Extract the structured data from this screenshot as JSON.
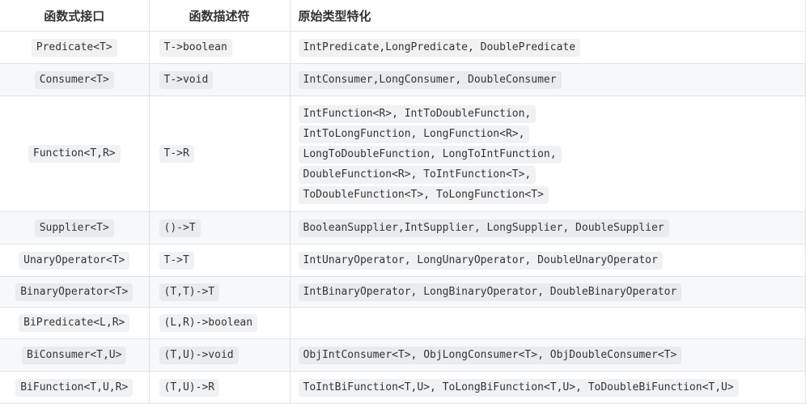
{
  "headers": [
    "函数式接口",
    "函数描述符",
    "原始类型特化"
  ],
  "rows": [
    {
      "iface": "Predicate<T>",
      "desc": "T->boolean",
      "special": [
        "IntPredicate,LongPredicate, DoublePredicate"
      ]
    },
    {
      "iface": "Consumer<T>",
      "desc": "T->void",
      "special": [
        "IntConsumer,LongConsumer, DoubleConsumer"
      ]
    },
    {
      "iface": "Function<T,R>",
      "desc": "T->R",
      "special": [
        "IntFunction<R>, IntToDoubleFunction,",
        "IntToLongFunction, LongFunction<R>,",
        "LongToDoubleFunction, LongToIntFunction,",
        "DoubleFunction<R>, ToIntFunction<T>,",
        "ToDoubleFunction<T>, ToLongFunction<T>"
      ]
    },
    {
      "iface": "Supplier<T>",
      "desc": "()->T",
      "special": [
        "BooleanSupplier,IntSupplier, LongSupplier, DoubleSupplier"
      ]
    },
    {
      "iface": "UnaryOperator<T>",
      "desc": "T->T",
      "special": [
        "IntUnaryOperator, LongUnaryOperator, DoubleUnaryOperator"
      ]
    },
    {
      "iface": "BinaryOperator<T>",
      "desc": "(T,T)->T",
      "special": [
        "IntBinaryOperator, LongBinaryOperator, DoubleBinaryOperator"
      ]
    },
    {
      "iface": "BiPredicate<L,R>",
      "desc": "(L,R)->boolean",
      "special": []
    },
    {
      "iface": "BiConsumer<T,U>",
      "desc": "(T,U)->void",
      "special": [
        "ObjIntConsumer<T>, ObjLongConsumer<T>, ObjDoubleConsumer<T>"
      ]
    },
    {
      "iface": "BiFunction<T,U,R>",
      "desc": "(T,U)->R",
      "special": [
        "ToIntBiFunction<T,U>, ToLongBiFunction<T,U>, ToDoubleBiFunction<T,U>"
      ]
    }
  ]
}
